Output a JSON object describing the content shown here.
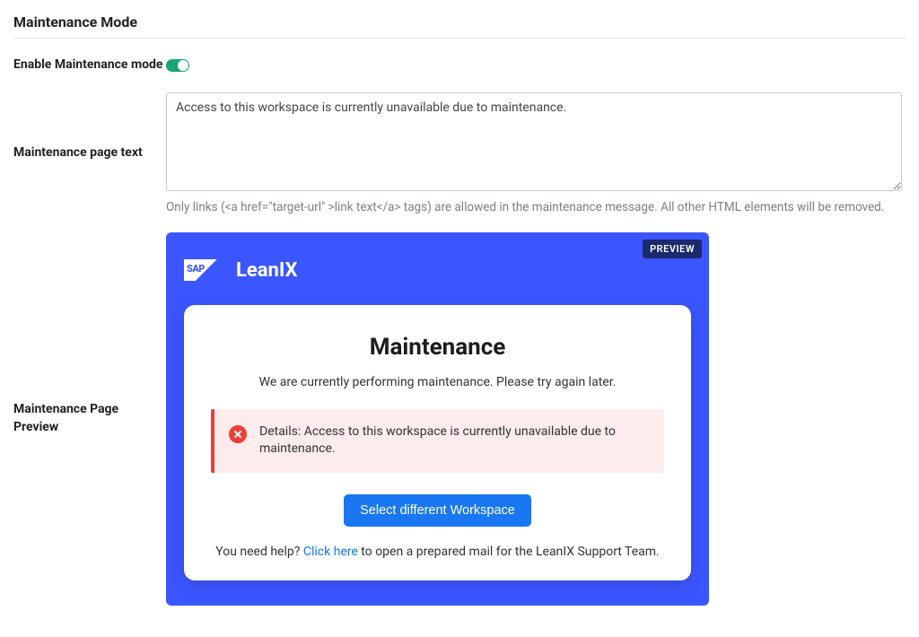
{
  "section": {
    "title": "Maintenance Mode"
  },
  "fields": {
    "enable": {
      "label": "Enable Maintenance mode"
    },
    "text": {
      "label": "Maintenance page text",
      "value": "Access to this workspace is currently unavailable due to maintenance.",
      "help": "Only links (<a href=\"target-url\" >link text</a> tags) are allowed in the maintenance message. All other HTML elements will be removed."
    },
    "preview": {
      "label": "Maintenance Page Preview"
    }
  },
  "preview": {
    "badge": "PREVIEW",
    "logo": {
      "sap": "SAP",
      "brand": "LeanIX"
    },
    "card": {
      "title": "Maintenance",
      "subtitle": "We are currently performing maintenance. Please try again later.",
      "alert_prefix": "Details: ",
      "alert_message": "Access to this workspace is currently unavailable due to maintenance.",
      "button": "Select different Workspace",
      "help_before": "You need help? ",
      "help_link": "Click here",
      "help_after": " to open a prepared mail for the LeanIX Support Team."
    }
  }
}
